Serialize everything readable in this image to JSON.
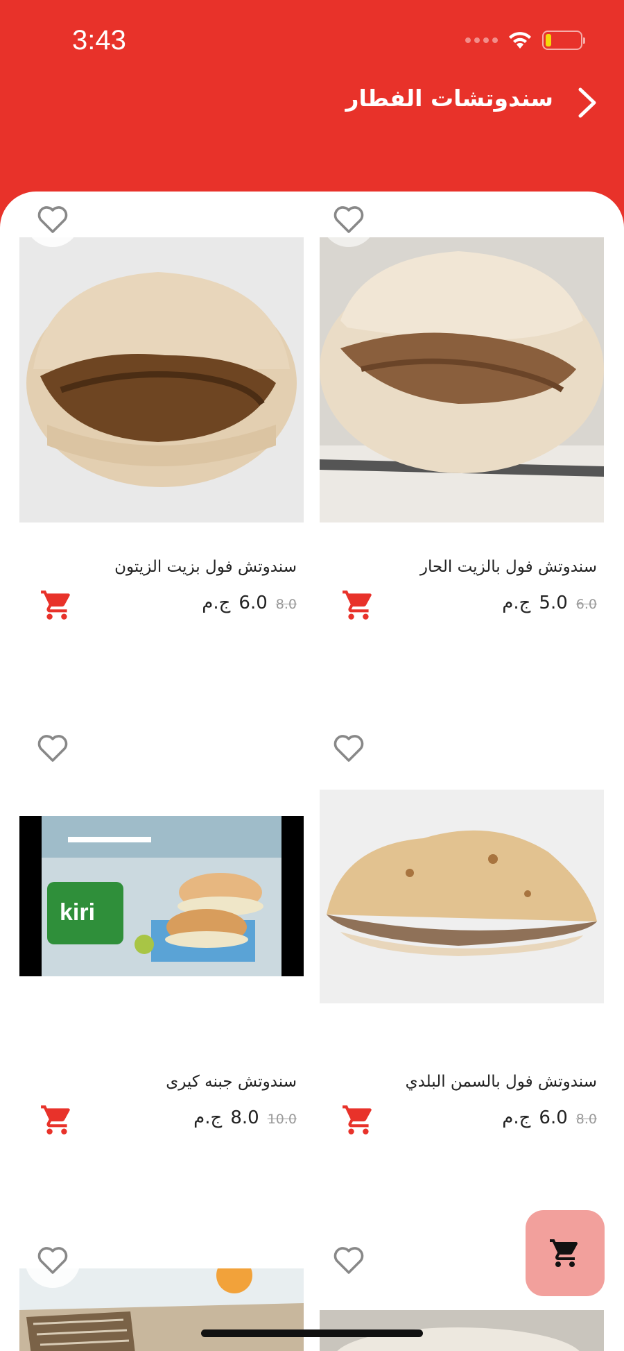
{
  "status": {
    "time": "3:43"
  },
  "header": {
    "title": "سندوتشات الفطار"
  },
  "colors": {
    "brand": "#e8322a",
    "fab": "#f2a09c",
    "cart": "#e8322a"
  },
  "products": [
    {
      "name": "سندوتش فول بالزيت الحار",
      "old_price": "6.0",
      "price": "5.0",
      "currency": "ج.م",
      "image": "foul-sandwich-hot-oil",
      "favorite": false
    },
    {
      "name": "سندوتش فول بزيت الزيتون",
      "old_price": "8.0",
      "price": "6.0",
      "currency": "ج.م",
      "image": "foul-sandwich-olive-oil",
      "favorite": false
    },
    {
      "name": "سندوتش فول بالسمن البلدي",
      "old_price": "8.0",
      "price": "6.0",
      "currency": "ج.م",
      "image": "foul-sandwich-ghee",
      "favorite": false
    },
    {
      "name": "سندوتش جبنه كيرى",
      "old_price": "10.0",
      "price": "8.0",
      "currency": "ج.م",
      "image": "kiri-cheese-sandwich",
      "image_text": "kiri",
      "favorite": false
    }
  ],
  "icons": {
    "back": "chevron-right-icon",
    "favorite": "heart-outline-icon",
    "cart": "cart-icon",
    "fab": "cart-icon"
  }
}
